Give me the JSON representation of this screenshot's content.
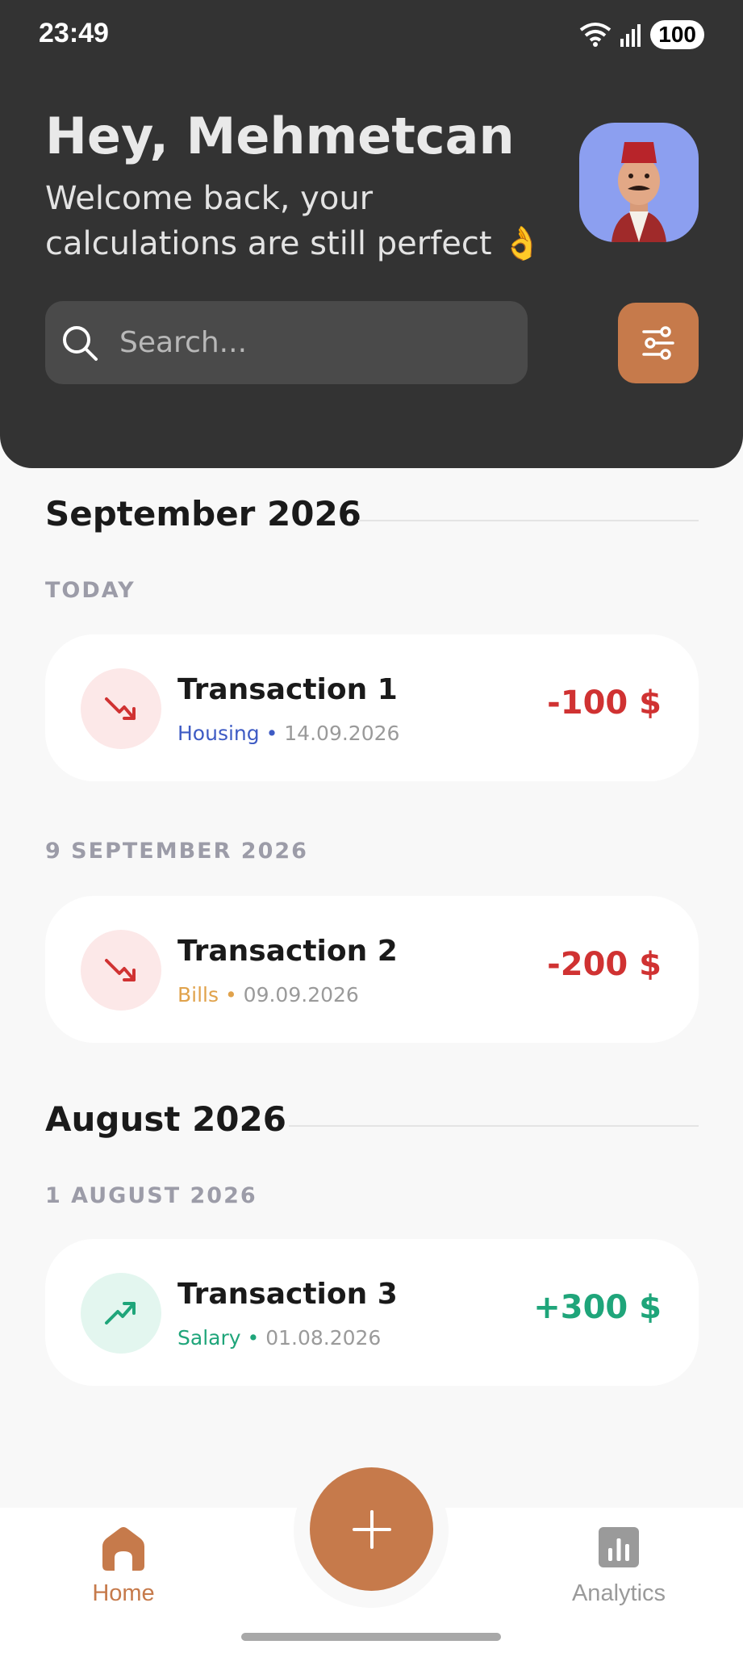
{
  "status_bar": {
    "time": "23:49",
    "battery": "100"
  },
  "header": {
    "greeting": "Hey, Mehmetcan",
    "welcome_line1": "Welcome back, your",
    "welcome_line2": "calculations are still perfect 👌"
  },
  "search": {
    "placeholder": "Search..."
  },
  "sections": [
    {
      "month": "September 2026",
      "groups": [
        {
          "day_label": "TODAY",
          "transactions": [
            {
              "title": "Transaction 1",
              "category": "Housing",
              "date": "14.09.2026",
              "amount": "-100 $",
              "direction": "down"
            }
          ]
        },
        {
          "day_label": "9 SEPTEMBER 2026",
          "transactions": [
            {
              "title": "Transaction 2",
              "category": "Bills",
              "date": "09.09.2026",
              "amount": "-200 $",
              "direction": "down"
            }
          ]
        }
      ]
    },
    {
      "month": "August 2026",
      "groups": [
        {
          "day_label": "1 AUGUST 2026",
          "transactions": [
            {
              "title": "Transaction 3",
              "category": "Salary",
              "date": "01.08.2026",
              "amount": "+300 $",
              "direction": "up"
            }
          ]
        }
      ]
    }
  ],
  "separator": "•",
  "nav": {
    "home_label": "Home",
    "analytics_label": "Analytics"
  },
  "colors": {
    "accent": "#c67a4b",
    "header_bg": "#333333",
    "expense": "#d03232",
    "income": "#1fa57a",
    "housing": "#3e5bc4",
    "bills": "#e0a24b",
    "salary": "#1fa57a",
    "nav_inactive": "#9a9a9a"
  },
  "icons": {
    "search": "search-icon",
    "filter": "sliders-icon",
    "expense": "trend-down-icon",
    "income": "trend-up-icon",
    "add": "plus-icon",
    "home": "home-icon",
    "analytics": "bar-chart-icon"
  }
}
